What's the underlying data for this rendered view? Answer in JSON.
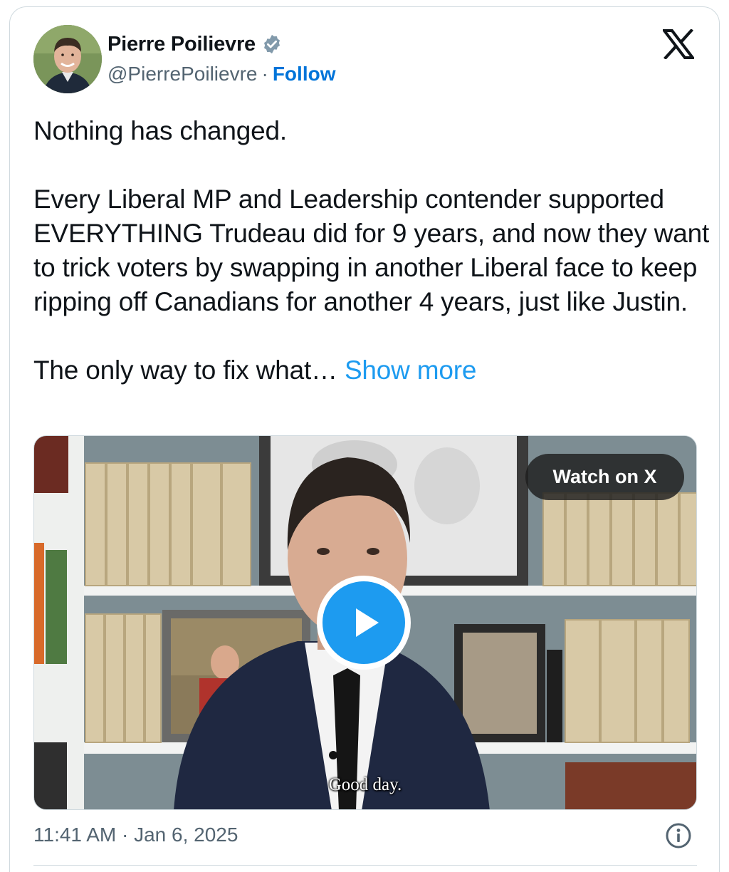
{
  "author": {
    "name": "Pierre Poilievre",
    "handle": "@PierrePoilievre",
    "separator": "·",
    "follow_label": "Follow",
    "avatar_icon": "profile-photo",
    "verified_icon": "verified-badge-icon"
  },
  "brand": {
    "logo": "x-logo-icon"
  },
  "tweet": {
    "paragraphs": [
      "Nothing has changed.",
      "Every Liberal MP and Leadership contender supported EVERYTHING Trudeau did for 9 years, and now they want to trick voters by swapping in another Liberal face to keep ripping off Canadians for another 4 years, just like Justin.",
      "The only way to fix what…"
    ],
    "show_more_label": "Show more"
  },
  "media": {
    "watch_label": "Watch on X",
    "play_icon": "play-icon",
    "caption": "Good day."
  },
  "footer": {
    "timestamp": "11:41 AM · Jan 6, 2025",
    "info_icon": "info-icon"
  },
  "colors": {
    "link": "#1d9bf0",
    "follow": "#0074d9",
    "text": "#0f1419",
    "muted": "#536471",
    "border": "#cfd9de"
  }
}
